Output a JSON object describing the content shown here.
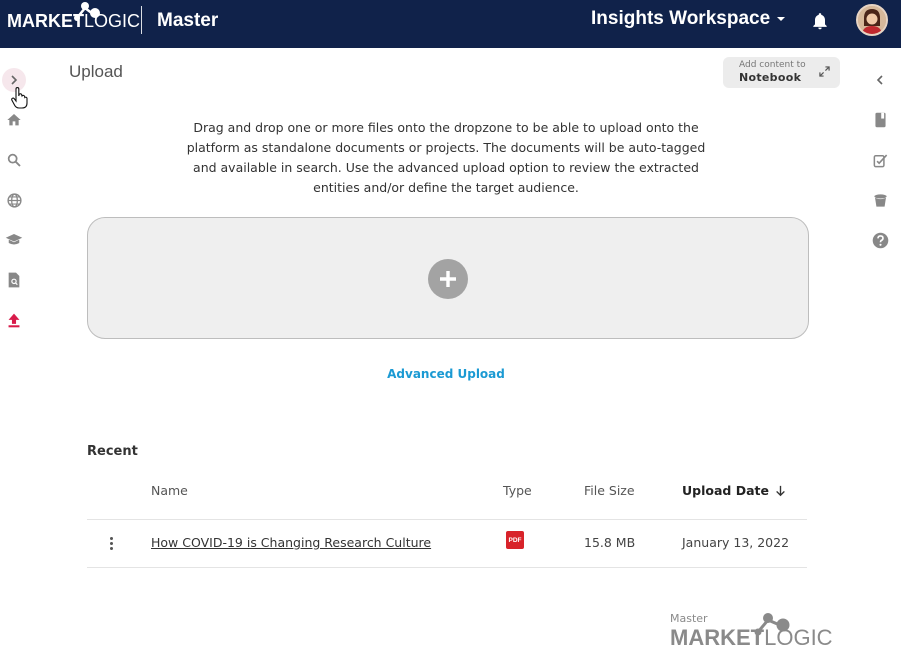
{
  "header": {
    "logo_left": "MARKET",
    "logo_right": "LOGIC",
    "app_title": "Master",
    "workspace": "Insights Workspace"
  },
  "page": {
    "title": "Upload",
    "notebook_small": "Add content to",
    "notebook_big": "Notebook",
    "description": "Drag and drop one or more files onto the dropzone to be able to upload onto the platform as standalone documents or projects. The documents will be auto-tagged and available in search. Use the advanced upload option to review the extracted entities and/or define the target audience.",
    "advanced_upload": "Advanced Upload"
  },
  "recent": {
    "title": "Recent",
    "columns": {
      "name": "Name",
      "type": "Type",
      "size": "File Size",
      "date": "Upload Date"
    },
    "rows": [
      {
        "name": "How COVID-19 is Changing Research Culture",
        "type": "PDF",
        "size": "15.8 MB",
        "date": "January 13, 2022"
      }
    ]
  },
  "footer": {
    "small": "Master",
    "brand_left": "MARKET",
    "brand_right": "LOGIC"
  },
  "colors": {
    "header_bg": "#10224a",
    "accent_blue": "#1b9ad3",
    "upload_active": "#d81b4a",
    "pdf_red": "#d8232a"
  }
}
